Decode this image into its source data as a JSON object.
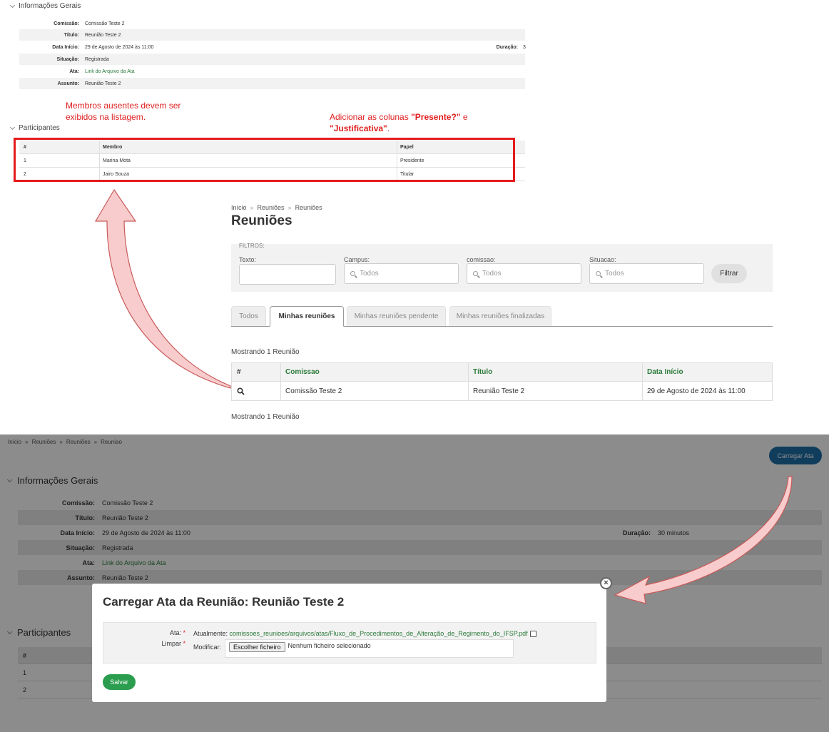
{
  "top": {
    "info_header": "Informações Gerais",
    "fields": [
      {
        "label": "Comissão:",
        "value": "Comissão Teste 2"
      },
      {
        "label": "Título:",
        "value": "Reunião Teste 2"
      },
      {
        "label": "Data Início:",
        "value": "29 de Agosto de 2024 às 11:00",
        "extra_label": "Duração:",
        "extra_value": "3"
      },
      {
        "label": "Situação:",
        "value": "Registrada"
      },
      {
        "label": "Ata:",
        "value": "Link do Arquivo da Ata"
      },
      {
        "label": "Assunto:",
        "value": "Reunião Teste 2"
      }
    ],
    "participants_header": "Participantes",
    "participants_columns": [
      "#",
      "Membro",
      "Papel"
    ],
    "participants_rows": [
      {
        "n": "1",
        "membro": "Marina Mota",
        "papel": "Presidente"
      },
      {
        "n": "2",
        "membro": "Jairo Souza",
        "papel": "Titular"
      }
    ]
  },
  "annotations": {
    "note_left_line1": "Membros ausentes devem ser",
    "note_left_line2": "exibidos na listagem.",
    "note_right_prefix": "Adicionar as colunas ",
    "note_right_bold1": "\"Presente?\"",
    "note_right_mid": " e",
    "note_right_bold2": "\"Justificativa\"",
    "note_right_suffix": "."
  },
  "list_page": {
    "breadcrumb": [
      "Início",
      "Reuniões",
      "Reuniões"
    ],
    "breadcrumb_sep": "»",
    "title": "Reuniões",
    "filters_legend": "FILTROS:",
    "filters": {
      "texto_label": "Texto:",
      "campus_label": "Campus:",
      "campus_value": "Todos",
      "comissao_label": "comissao:",
      "comissao_value": "Todos",
      "situacao_label": "Situacao:",
      "situacao_value": "Todos",
      "filter_button": "Filtrar"
    },
    "tabs": [
      "Todos",
      "Minhas reuniões",
      "Minhas reuniões pendente",
      "Minhas reuniões finalizadas"
    ],
    "count_text": "Mostrando 1 Reunião",
    "columns": [
      "#",
      "Comissao",
      "Título",
      "Data Início"
    ],
    "rows": [
      {
        "comissao": "Comissão Teste 2",
        "titulo": "Reunião Teste 2",
        "data": "29 de Agosto de 2024 às 11:00"
      }
    ]
  },
  "detail_page": {
    "breadcrumb": [
      "Início",
      "Reuniões",
      "Reuniões",
      "Reuniao"
    ],
    "breadcrumb_sep": "»",
    "upload_button": "Carregar Ata",
    "info_header": "Informações Gerais",
    "fields": [
      {
        "label": "Comissão:",
        "value": "Comissão Teste 2"
      },
      {
        "label": "Título:",
        "value": "Reunião Teste 2"
      },
      {
        "label": "Data Início:",
        "value": "29 de Agosto de 2024 às 11:00",
        "extra_label": "Duração:",
        "extra_value": "30 minutos"
      },
      {
        "label": "Situação:",
        "value": "Registrada"
      },
      {
        "label": "Ata:",
        "value": "Link do Arquivo da Ata"
      },
      {
        "label": "Assunto:",
        "value": "Reunião Teste 2"
      }
    ],
    "participants_header": "Participantes",
    "participants_col": "#",
    "participants_rows": [
      "1",
      "2"
    ]
  },
  "modal": {
    "title": "Carregar Ata da Reunião: Reunião Teste 2",
    "ata_label": "Ata:",
    "limpar_label": "Limpar",
    "required_mark": "*",
    "currently_label": "Atualmente:",
    "current_file": "comissoes_reunioes/arquivos/atas/Fluxo_de_Procedimentos_de_Alteração_de_Regimento_do_IFSP.pdf",
    "modify_label": "Modificar:",
    "choose_file": "Escolher ficheiro",
    "no_file": "Nenhum ficheiro selecionado",
    "save_button": "Salvar",
    "close_glyph": "×"
  },
  "colors": {
    "annotation_red": "#e41b1b",
    "link_green": "#2b7a3a",
    "primary_blue": "#1e6fa8",
    "save_green": "#2a9d4f",
    "arrow_fill": "#f8cccc",
    "arrow_stroke": "#c85a5a"
  }
}
